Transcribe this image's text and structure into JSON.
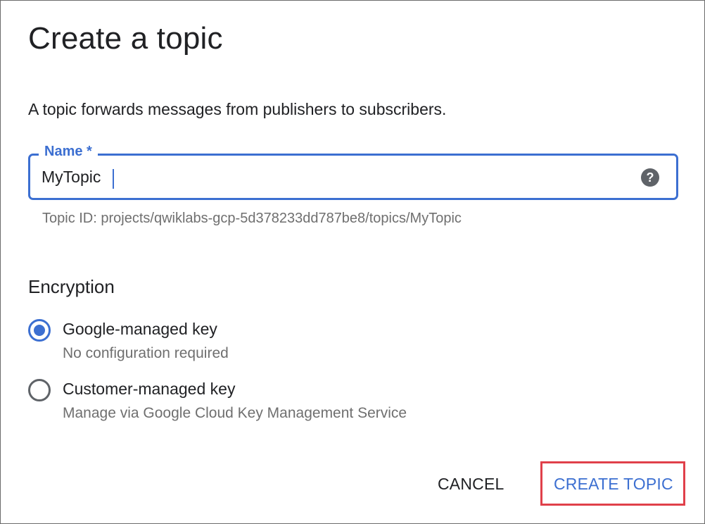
{
  "dialog": {
    "title": "Create a topic",
    "description": "A topic forwards messages from publishers to subscribers."
  },
  "name_field": {
    "label": "Name *",
    "value": "MyTopic",
    "help_icon": "help-icon",
    "topic_id_text": "Topic ID: projects/qwiklabs-gcp-5d378233dd787be8/topics/MyTopic"
  },
  "encryption": {
    "heading": "Encryption",
    "options": [
      {
        "label": "Google-managed key",
        "sublabel": "No configuration required",
        "selected": true
      },
      {
        "label": "Customer-managed key",
        "sublabel": "Manage via Google Cloud Key Management Service",
        "selected": false
      }
    ]
  },
  "actions": {
    "cancel_label": "CANCEL",
    "create_label": "CREATE TOPIC"
  },
  "colors": {
    "accent": "#3c6fd1",
    "highlight_border": "#e0404a",
    "text_primary": "#202124",
    "text_secondary": "#6f6f6f"
  }
}
